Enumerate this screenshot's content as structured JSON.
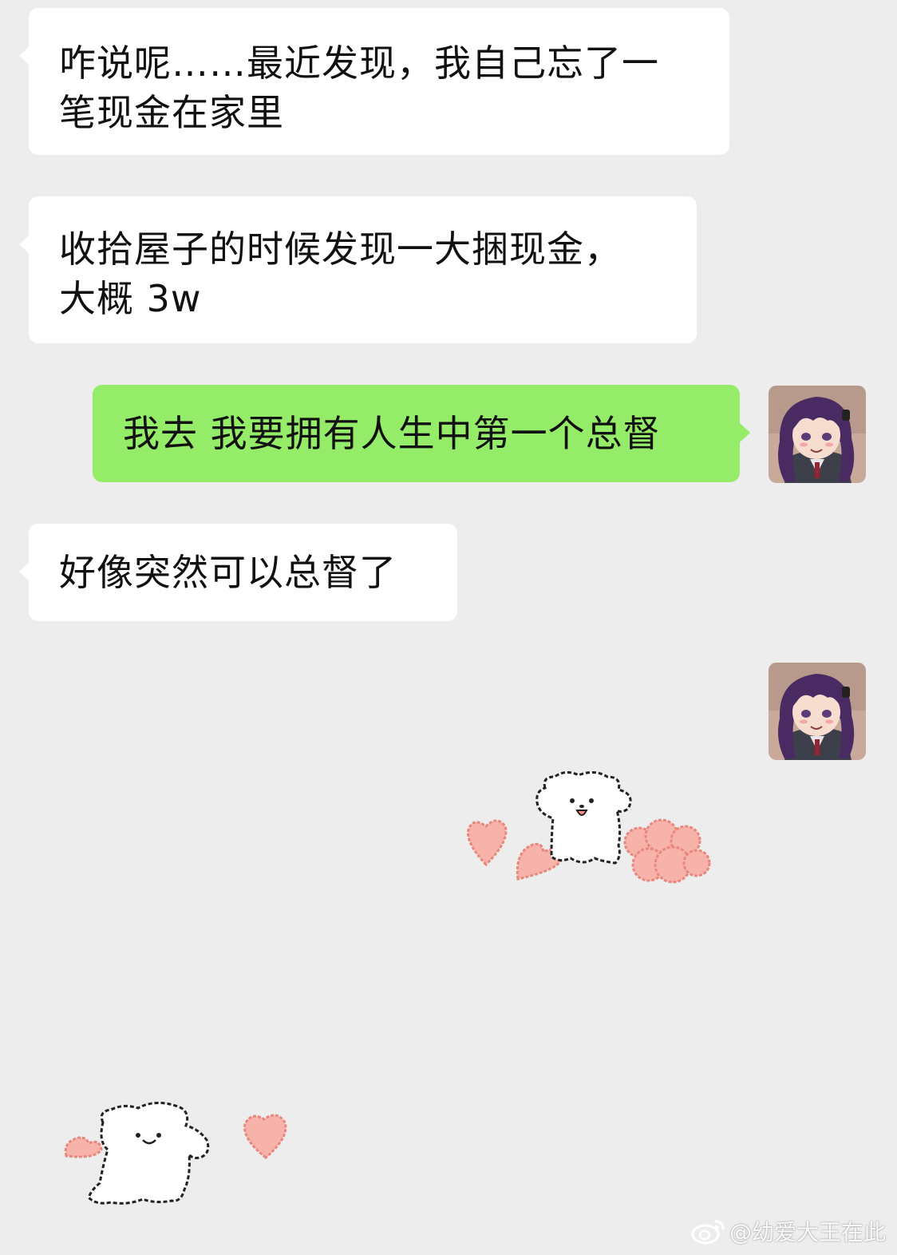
{
  "messages": [
    {
      "side": "left",
      "lines": [
        "咋说呢……最近发现，我自己忘了一",
        "笔现金在家里"
      ]
    },
    {
      "side": "left",
      "lines": [
        "收拾屋子的时候发现一大捆现金，",
        "大概 3w"
      ]
    },
    {
      "side": "right",
      "lines": [
        "我去 我要拥有人生中第一个总督"
      ]
    },
    {
      "side": "left",
      "lines": [
        "好像突然可以总督了"
      ]
    }
  ],
  "stickers": [
    {
      "name": "white-bear-with-hearts-sticker"
    },
    {
      "name": "white-bear-waving-hearts-sticker"
    }
  ],
  "watermark": {
    "text": "@幼爱大王在此",
    "icon": "weibo-icon"
  },
  "colors": {
    "background": "#ededed",
    "incoming_bubble": "#ffffff",
    "outgoing_bubble": "#95ec69",
    "avatar_hair": "#4a2a63",
    "heart": "#f5a9a0"
  }
}
